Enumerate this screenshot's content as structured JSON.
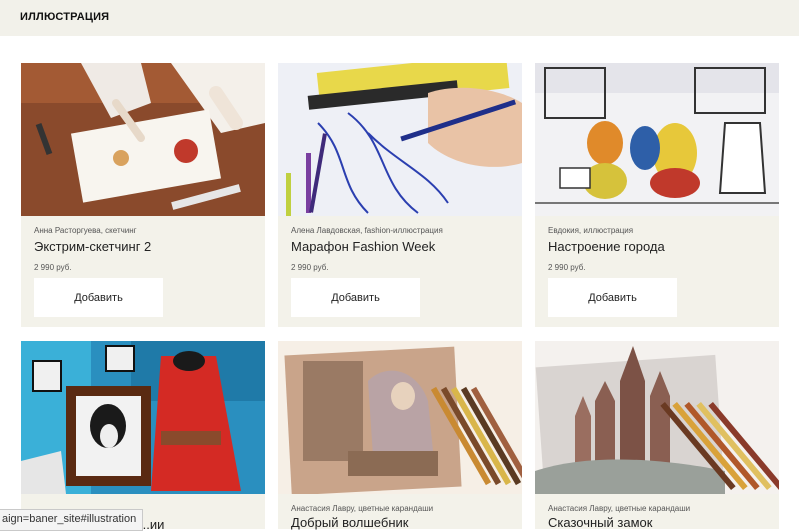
{
  "header": {
    "title": "ИЛЛЮСТРАЦИЯ"
  },
  "colors": {
    "header_bg": "#f2f1ea",
    "card_bg": "#f3f2ea",
    "button_bg": "#ffffff"
  },
  "products": [
    {
      "author": "Анна Расторгуева, скетчинг",
      "title": "Экстрим-скетчинг 2",
      "price": "2 990 руб.",
      "button": "Добавить"
    },
    {
      "author": "Алена Лавдовская, fashion-иллюстрация",
      "title": "Марафон Fashion Week",
      "price": "2 990 руб.",
      "button": "Добавить"
    },
    {
      "author": "Евдокия, иллюстрация",
      "title": "Настроение города",
      "price": "2 990 руб.",
      "button": "Добавить"
    },
    {
      "author": "",
      "title": "...ии",
      "price": "",
      "button": ""
    },
    {
      "author": "Анастасия Лавру, цветные карандаши",
      "title": "Добрый волшебник",
      "price": "",
      "button": ""
    },
    {
      "author": "Анастасия Лавру, цветные карандаши",
      "title": "Сказочный замок",
      "price": "",
      "button": ""
    }
  ],
  "status_bar": {
    "url": "aign=baner_site#illustration"
  }
}
